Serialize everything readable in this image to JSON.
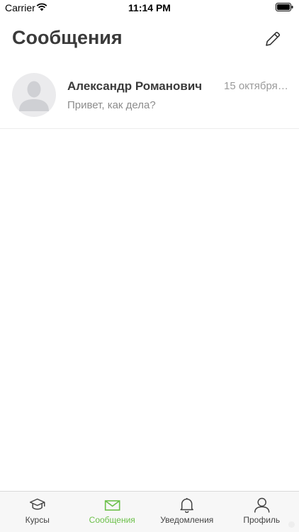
{
  "status_bar": {
    "carrier": "Carrier",
    "time": "11:14 PM"
  },
  "header": {
    "title": "Сообщения"
  },
  "conversations": [
    {
      "name": "Александр Романович",
      "date": "15 октября 2...",
      "preview": "Привет, как дела?"
    }
  ],
  "tabs": [
    {
      "label": "Курсы",
      "icon": "graduation-cap-icon",
      "active": false
    },
    {
      "label": "Сообщения",
      "icon": "envelope-icon",
      "active": true
    },
    {
      "label": "Уведомления",
      "icon": "bell-icon",
      "active": false
    },
    {
      "label": "Профиль",
      "icon": "user-icon",
      "active": false
    }
  ],
  "colors": {
    "accent": "#6cc04a",
    "tab_bar_bg": "#f7f7f7",
    "title": "#3a3a3a"
  }
}
